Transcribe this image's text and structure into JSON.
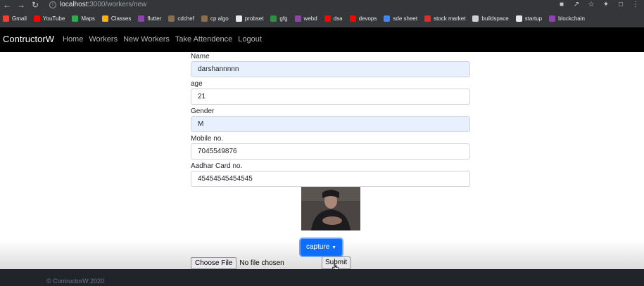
{
  "browser": {
    "url_host": "localhost:",
    "url_path": "3000/workers/new",
    "bookmarks": [
      {
        "label": "Gmail",
        "color": "#ea4335"
      },
      {
        "label": "YouTube",
        "color": "#ff0000"
      },
      {
        "label": "Maps",
        "color": "#34a853"
      },
      {
        "label": "Classes",
        "color": "#f4b400"
      },
      {
        "label": "flutter",
        "color": "#8e44ad"
      },
      {
        "label": "cdchef",
        "color": "#8b6e4e"
      },
      {
        "label": "cp algo",
        "color": "#8b6e4e"
      },
      {
        "label": "probset",
        "color": "#e8e8e8"
      },
      {
        "label": "gfg",
        "color": "#2f8d46"
      },
      {
        "label": "webd",
        "color": "#8e44ad"
      },
      {
        "label": "dsa",
        "color": "#ff0000"
      },
      {
        "label": "devops",
        "color": "#ff0000"
      },
      {
        "label": "sde sheet",
        "color": "#4285f4"
      },
      {
        "label": "stock market",
        "color": "#d93025"
      },
      {
        "label": "buildspace",
        "color": "#cfcfcf"
      },
      {
        "label": "startup",
        "color": "#e8e8e8"
      },
      {
        "label": "blockchain",
        "color": "#8e44ad"
      }
    ]
  },
  "navbar": {
    "brand": "ContructorW",
    "links": [
      "Home",
      "Workers",
      "New Workers",
      "Take Attendence",
      "Logout"
    ]
  },
  "form": {
    "fields": [
      {
        "label": "Name",
        "value": "darshannnnn",
        "autofill": true
      },
      {
        "label": "age",
        "value": "21",
        "autofill": false
      },
      {
        "label": "Gender",
        "value": "M",
        "autofill": true
      },
      {
        "label": "Mobile no.",
        "value": "7045549876",
        "autofill": false
      },
      {
        "label": "Aadhar Card no.",
        "value": "45454545454545",
        "autofill": false
      }
    ],
    "capture_label": "capture",
    "choose_file_label": "Choose File",
    "no_file_text": "No file chosen",
    "submit_label": "Submit"
  },
  "footer": {
    "copyright": "© ContructorW 2020"
  },
  "colors": {
    "primary": "#0d6efd",
    "navbar": "#000000",
    "footer": "#212529",
    "autofill": "#e8f0fe"
  }
}
